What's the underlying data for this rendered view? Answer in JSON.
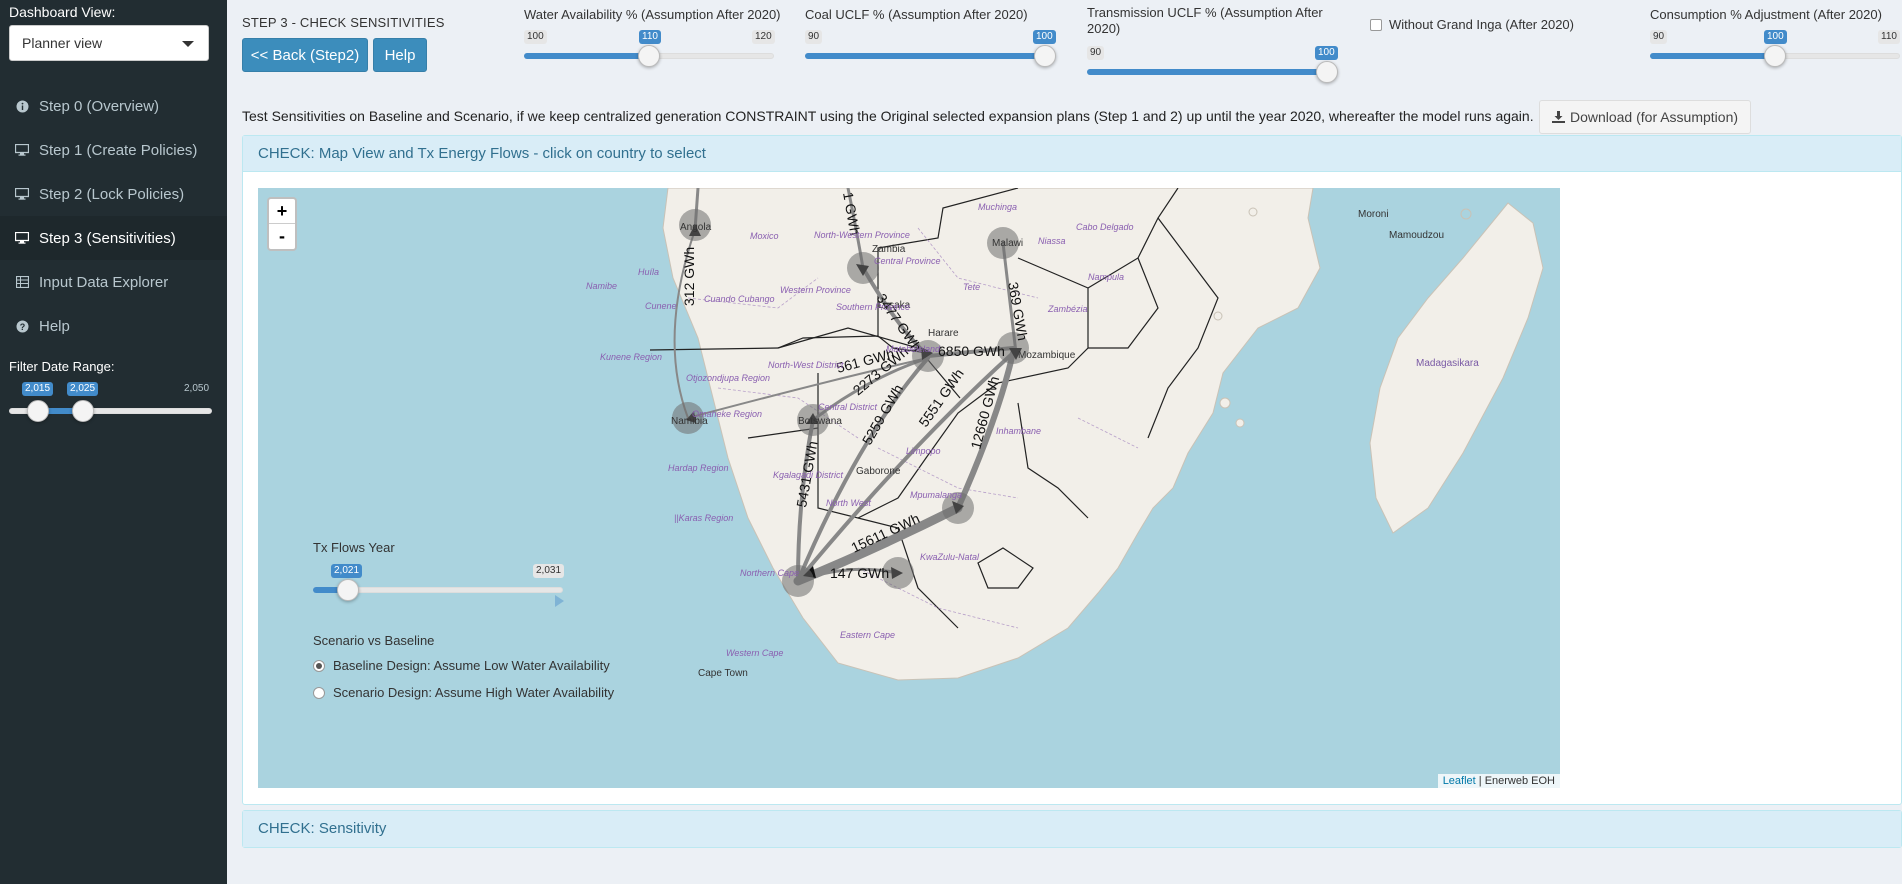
{
  "sidebar": {
    "view_label": "Dashboard View:",
    "view_selected": "Planner view",
    "items": [
      {
        "label": "Step 0 (Overview)",
        "icon": "info-icon"
      },
      {
        "label": "Step 1 (Create Policies)",
        "icon": "desktop-icon"
      },
      {
        "label": "Step 2 (Lock Policies)",
        "icon": "desktop-icon"
      },
      {
        "label": "Step 3 (Sensitivities)",
        "icon": "desktop-icon",
        "active": true
      },
      {
        "label": "Input Data Explorer",
        "icon": "table-icon"
      },
      {
        "label": "Help",
        "icon": "question-icon"
      }
    ],
    "filter_label": "Filter Date Range:",
    "date_range": {
      "min": "2,015",
      "max": "2,050",
      "from": "2,015",
      "to": "2,025",
      "from_fraction": 0.0,
      "to_fraction": 0.2857
    }
  },
  "header": {
    "step_title": "STEP 3 - CHECK SENSITIVITIES",
    "back_button": "<< Back (Step2)",
    "help_button": "Help",
    "water": {
      "label": "Water Availability % (Assumption After 2020)",
      "min": "100",
      "max": "120",
      "value": "110",
      "fraction": 0.5
    },
    "coal": {
      "label": "Coal UCLF % (Assumption After 2020)",
      "min": "90",
      "max": "100",
      "value": "100",
      "fraction": 1.0
    },
    "transmission": {
      "label": "Transmission UCLF % (Assumption After 2020)",
      "min": "90",
      "max": "100",
      "value": "100",
      "fraction": 1.0
    },
    "inga_checkbox": "Without Grand Inga (After 2020)",
    "consumption": {
      "label": "Consumption % Adjustment (After 2020)",
      "min": "90",
      "max": "110",
      "value": "100",
      "fraction": 0.5
    }
  },
  "description": "Test Sensitivities on Baseline and Scenario, if we keep centralized generation CONSTRAINT using the Original selected expansion plans (Step 1 and 2) up until the year 2020, whereafter the model runs again.",
  "download_button": "Download (for Assumption)",
  "map_box": {
    "title": "CHECK: Map View and Tx Energy Flows - click on country to select",
    "zoom_in": "+",
    "zoom_out": "-",
    "attribution_link": "Leaflet",
    "attribution_text": " | Enerweb EOH",
    "tx_year": {
      "label": "Tx Flows Year",
      "min": "2,021",
      "max": "2,031",
      "value": "2,021",
      "fraction": 0.0
    },
    "scenario_label": "Scenario vs Baseline",
    "radio_baseline": "Baseline Design: Assume Low Water Availability",
    "radio_scenario": "Scenario Design: Assume High Water Availability",
    "places": [
      "Angola",
      "Zambia",
      "Lusaka",
      "Malawi",
      "Harare",
      "Mozambique",
      "Namibia",
      "Botswana",
      "Gaborone",
      "Moroni",
      "Mamoudzou",
      "Madagasikara",
      "Cape Town",
      "Muchinga",
      "Niassa",
      "Cabo Delgado",
      "Nampula",
      "Tete",
      "Zambézia",
      "Inhambane",
      "Limpopo",
      "Mpumalanga",
      "KwaZulu-Natal",
      "Eastern Cape",
      "Western Cape",
      "Northern Cape",
      "North West",
      "Kunene Region",
      "Hardap Region",
      "Huíla",
      "Namibe",
      "Cunene",
      "Cuando Cubango",
      "Moxico",
      "Central Province",
      "Western Province",
      "Southern Province",
      "North-Western Province",
      "Matabeleland",
      "North-West District",
      "Otjozondjupa Region",
      "Omaheke Region",
      "Central District",
      "Kgalagadi District",
      "||Karas Region"
    ],
    "flows": [
      "312 GWh",
      "1 GWh",
      "3477 GWh",
      "369 GWh",
      "6850 GWh",
      "561 GWh",
      "2273 GWh",
      "5259 GWh",
      "5551 GWh",
      "12660 GWh",
      "5431 GWh",
      "15611 GWh",
      "147 GWh"
    ]
  },
  "sensitivity_box": {
    "title": "CHECK: Sensitivity"
  }
}
